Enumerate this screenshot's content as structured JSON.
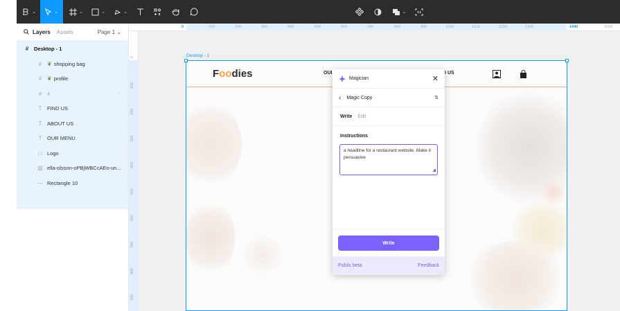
{
  "toolbar": {
    "center_icons": [
      "component-icon",
      "contrast-icon",
      "fill-icon",
      "code-icon"
    ]
  },
  "layers_panel": {
    "tab_layers": "Layers",
    "tab_assets": "Assets",
    "page_selector": "Page 1",
    "root": "Desktop - 1",
    "items": [
      {
        "label": "shopping bag",
        "icon": "frame-icon",
        "emoji": true
      },
      {
        "label": "profile",
        "icon": "frame-icon",
        "emoji": true
      },
      {
        "label": "4",
        "icon": "frame-icon",
        "hidden": true
      },
      {
        "label": "FIND US",
        "icon": "text-icon"
      },
      {
        "label": "ABOUT US",
        "icon": "text-icon"
      },
      {
        "label": "OUR MENU",
        "icon": "text-icon"
      },
      {
        "label": "Logo",
        "icon": "rect-icon"
      },
      {
        "label": "ella-olsson-oPBjWBCcAEo-un...",
        "icon": "image-icon"
      },
      {
        "label": "Rectangle 10",
        "icon": "line-icon"
      }
    ]
  },
  "ruler": {
    "top_labels": [
      "0",
      "100",
      "200",
      "300",
      "400",
      "500",
      "600",
      "700",
      "800",
      "900",
      "1000",
      "1100",
      "1200",
      "1300",
      "1440",
      "1600"
    ],
    "left_labels": [
      "0",
      "100",
      "200",
      "300",
      "400",
      "500",
      "600",
      "700",
      "800",
      "900"
    ]
  },
  "canvas": {
    "frame_label": "Desktop - 1",
    "site": {
      "logo_left": "F",
      "logo_oo": "oo",
      "logo_right": "dies",
      "nav_left_fragment": "OUI",
      "nav_right_fragment": "D US"
    }
  },
  "magician": {
    "title": "Magician",
    "sub_title": "Magic Copy",
    "tab_write": "Write",
    "tab_edit": "Edit",
    "instructions_label": "Instructions",
    "instructions_value": "a headline for a restaurant website. Make it persuasive",
    "write_button": "Write",
    "public_beta": "Public beta",
    "feedback": "Feedback",
    "accent": "#7b61ff"
  },
  "colors": {
    "selection_blue": "#0d99ff",
    "toolbar_bg": "#2c2c2c",
    "logo_orange": "#f4a23a"
  }
}
